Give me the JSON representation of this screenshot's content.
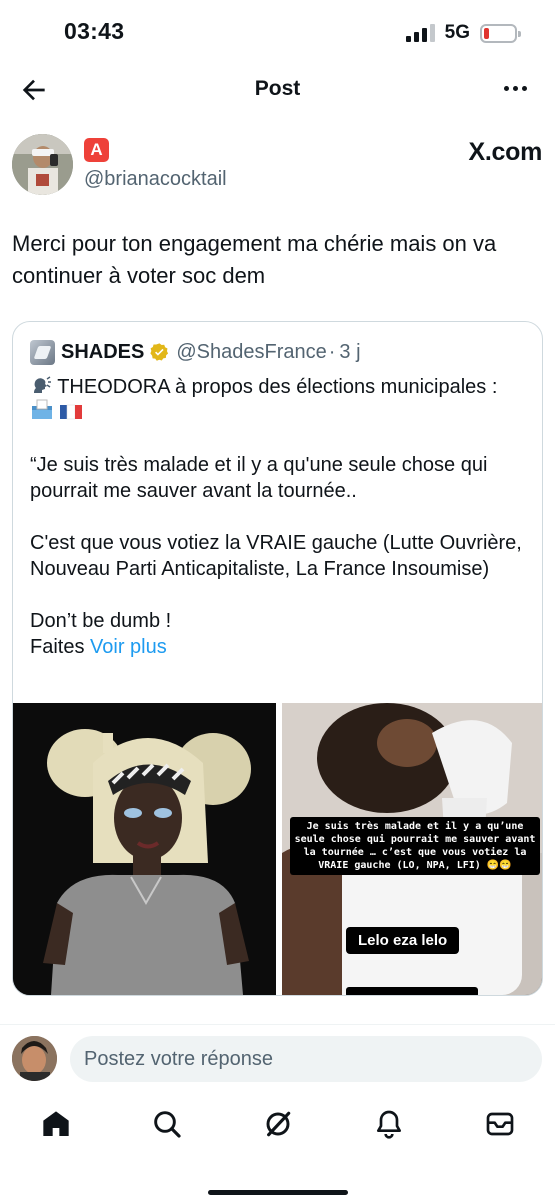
{
  "status_bar": {
    "time": "03:43",
    "network": "5G",
    "signal_bars_active": 3,
    "signal_bars_total": 4,
    "battery_level": 0.1,
    "battery_color": "#e0342f"
  },
  "header": {
    "title": "Post",
    "back_icon": "arrow-left-icon",
    "more_icon": "more-horizontal-icon"
  },
  "post": {
    "author_emoji": "🅰️",
    "author_handle": "@brianacocktail",
    "watermark": "X.com",
    "text": "Merci pour ton engagement ma chérie mais on va continuer à voter soc dem"
  },
  "quote": {
    "name": "SHADES",
    "handle": "@ShadesFrance",
    "dot": "·",
    "age": "3 j",
    "verified_color": "#e2b719",
    "line1": "THEODORA à propos des élections municipales :",
    "line1_emojis": [
      "speaking-head-icon",
      "ballot-box-icon",
      "france-flag-icon"
    ],
    "quote_p1": "“Je suis très malade et il y a qu'une seule chose qui pourrait me sauver avant la tournée..",
    "quote_p2": "C'est que vous votiez la VRAIE gauche (Lutte Ouvrière, Nouveau Parti Anticapitaliste, La France Insoumise)",
    "quote_p3": "Don’t be dumb !",
    "faites": "Faites",
    "voir_plus": "Voir plus",
    "media_right_subtitle": "Je suis très malade et il y a qu’une seule chose qui pourrait me sauver avant la tournée … c’est que vous votiez la VRAIE gauche (LO, NPA, LFI) 😁😁",
    "media_right_caption": "Lelo eza lelo"
  },
  "reply": {
    "placeholder": "Postez votre réponse"
  },
  "tabs": [
    {
      "name": "home",
      "icon": "home-icon",
      "active": true
    },
    {
      "name": "search",
      "icon": "search-icon",
      "active": false
    },
    {
      "name": "grok",
      "icon": "grok-icon",
      "active": false
    },
    {
      "name": "notifications",
      "icon": "bell-icon",
      "active": false
    },
    {
      "name": "messages",
      "icon": "mail-icon",
      "active": false
    }
  ],
  "colors": {
    "text": "#0f1419",
    "secondary": "#536471",
    "link": "#1d9bf0",
    "border": "#cfd9de"
  }
}
